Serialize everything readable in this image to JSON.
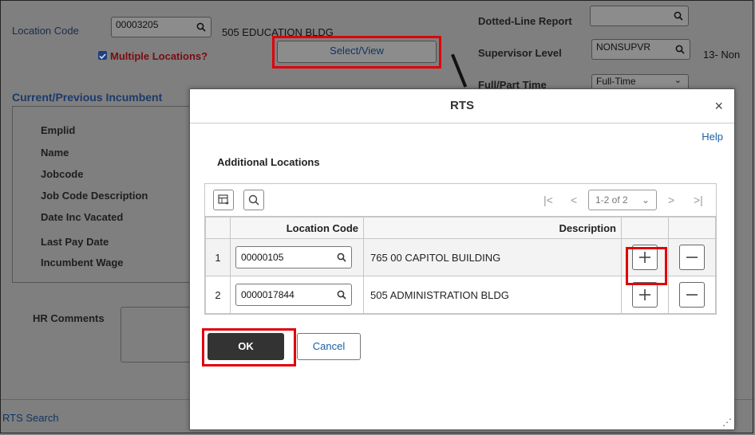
{
  "background": {
    "location_code_label": "Location Code",
    "location_code_value": "00003205",
    "location_desc": "505 EDUCATION BLDG",
    "multiple_locations_label": "Multiple Locations?",
    "select_view_label": "Select/View",
    "dotted_line_label": "Dotted-Line Report",
    "supervisor_level_label": "Supervisor Level",
    "supervisor_level_value": "NONSUPVR",
    "supervisor_level_desc": "13- Non",
    "full_part_label": "Full/Part Time",
    "full_part_value": "Full-Time",
    "section_title": "Current/Previous Incumbent",
    "fields": [
      "Emplid",
      "Name",
      "Jobcode",
      "Job Code Description",
      "Date Inc Vacated",
      "Last Pay Date",
      "Incumbent Wage"
    ],
    "hr_comments_label": "HR Comments",
    "footer_link": "RTS Search"
  },
  "modal": {
    "title": "RTS",
    "close_glyph": "×",
    "help_label": "Help",
    "subtitle": "Additional Locations",
    "grid": {
      "pager_text": "1-2 of 2",
      "col_location_code": "Location Code",
      "col_description": "Description",
      "rows": [
        {
          "num": "1",
          "code": "00000105",
          "description": "765 00 CAPITOL BUILDING"
        },
        {
          "num": "2",
          "code": "0000017844",
          "description": "505 ADMINISTRATION BLDG"
        }
      ]
    },
    "ok_label": "OK",
    "cancel_label": "Cancel"
  },
  "colors": {
    "highlight": "#e0000a",
    "overlay": "#7f7f7f",
    "primary_button": "#333333",
    "link": "#1b5fa5"
  }
}
